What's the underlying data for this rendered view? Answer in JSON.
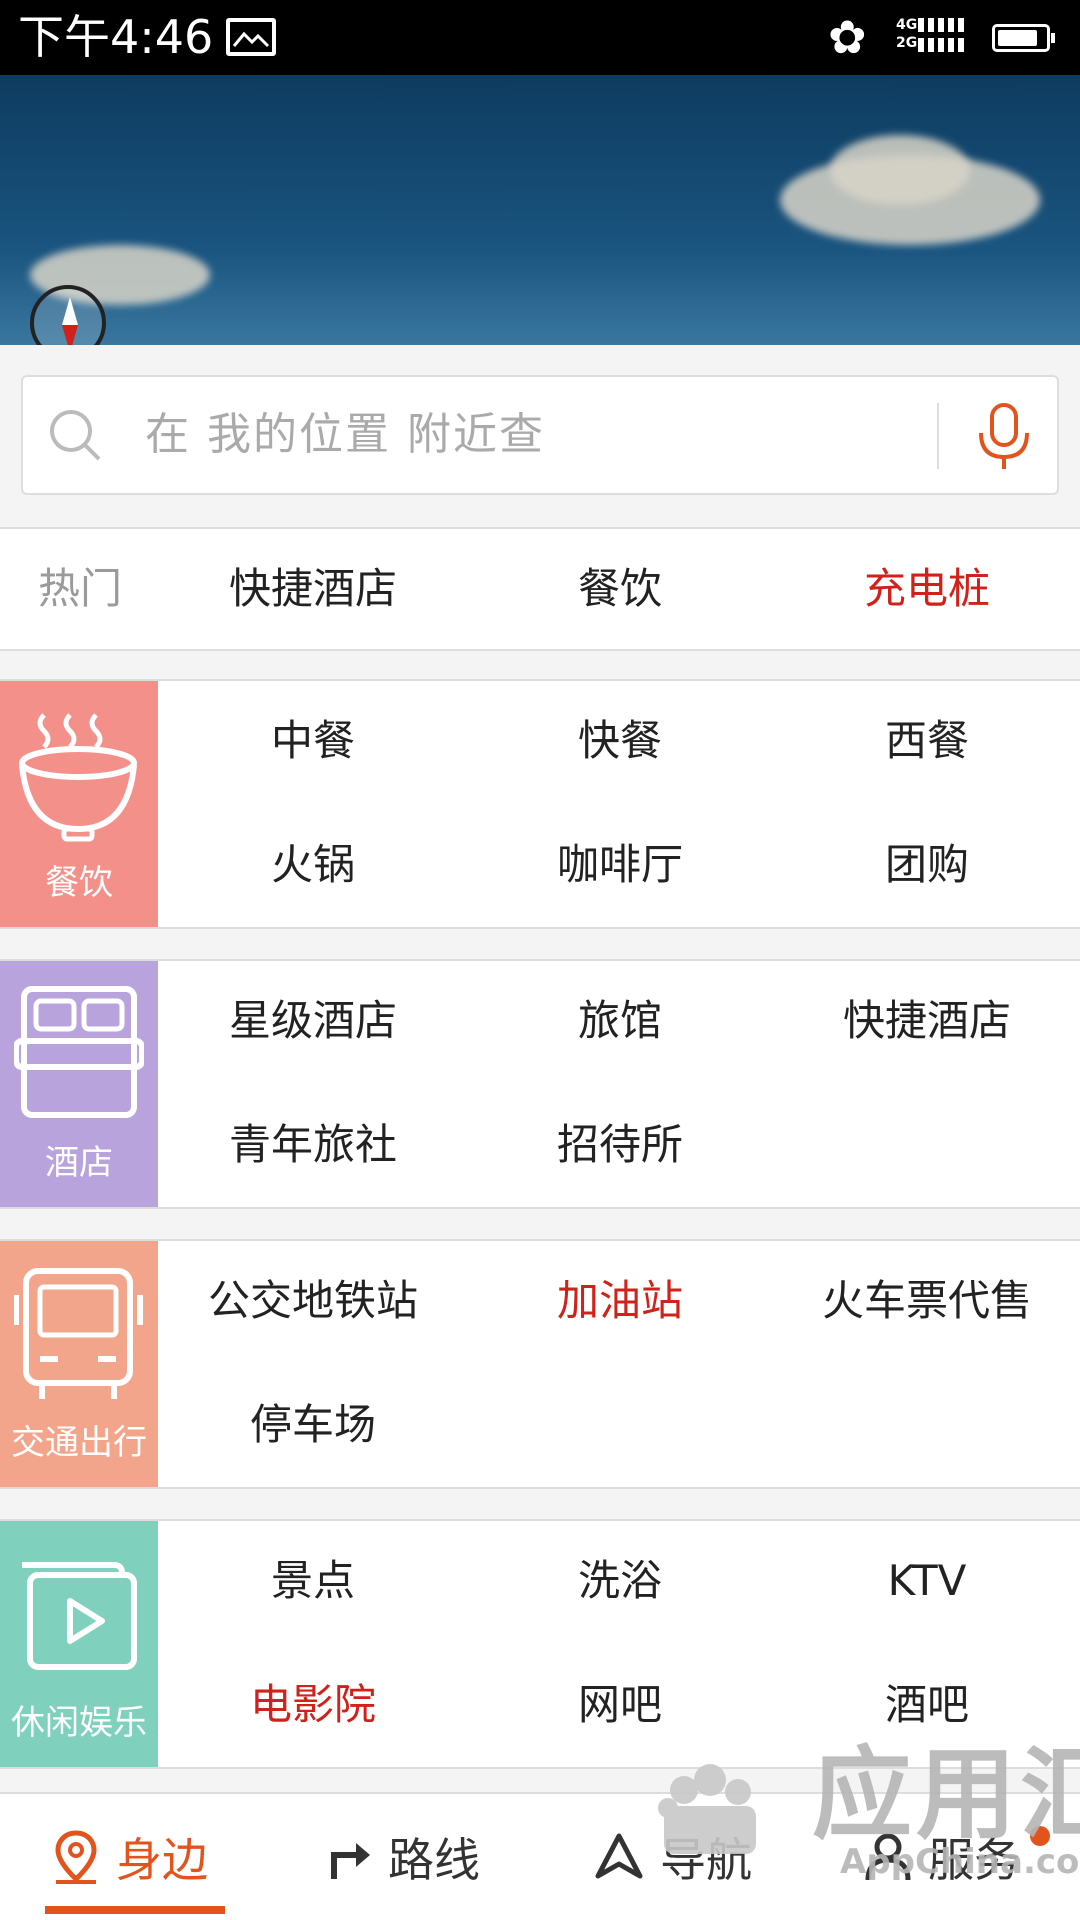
{
  "status_bar": {
    "time": "下午4:46",
    "net_4g": "4G",
    "net_2g": "2G",
    "battery_level": 0.85
  },
  "search": {
    "placeholder": "在 我的位置 附近查"
  },
  "hot": {
    "label": "热门",
    "items": [
      "快捷酒店",
      "餐饮",
      "充电桩"
    ]
  },
  "categories": [
    {
      "name": "餐饮",
      "color": "#f4908a",
      "icon": "bowl-icon",
      "items": [
        "中餐",
        "快餐",
        "西餐",
        "火锅",
        "咖啡厅",
        "团购"
      ]
    },
    {
      "name": "酒店",
      "color": "#b8a3dc",
      "icon": "bed-icon",
      "items": [
        "星级酒店",
        "旅馆",
        "快捷酒店",
        "青年旅社",
        "招待所"
      ]
    },
    {
      "name": "交通出行",
      "color": "#f3a58b",
      "icon": "bus-icon",
      "items": [
        "公交地铁站",
        "加油站",
        "火车票代售",
        "停车场"
      ]
    },
    {
      "name": "休闲娱乐",
      "color": "#7fd0bd",
      "icon": "video-icon",
      "items": [
        "景点",
        "洗浴",
        "KTV",
        "电影院",
        "网吧",
        "酒吧"
      ]
    }
  ],
  "highlight_color": "#d0221a",
  "accent_color": "#e2541d",
  "nav": {
    "items": [
      "身边",
      "路线",
      "导航",
      "服务"
    ]
  },
  "watermark": {
    "title": "应用汇",
    "url": "AppChina.com"
  }
}
